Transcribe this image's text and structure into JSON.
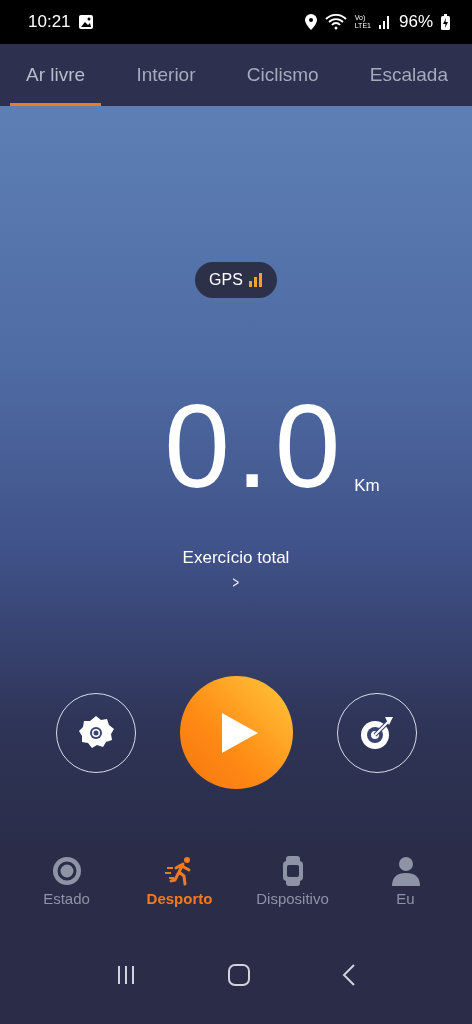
{
  "status_bar": {
    "time": "10:21",
    "network_top": "Vo)",
    "network_bottom": "LTE1",
    "battery": "96%"
  },
  "tabs": [
    {
      "label": "Ar livre",
      "selected": true
    },
    {
      "label": "Interior",
      "selected": false
    },
    {
      "label": "Ciclismo",
      "selected": false
    },
    {
      "label": "Escalada",
      "selected": false
    }
  ],
  "gps": {
    "label": "GPS"
  },
  "distance": {
    "value": "0.0",
    "unit": "Km",
    "caption": "Exercício total",
    "chevron": ">"
  },
  "bottom_nav": [
    {
      "label": "Estado",
      "kind": "status",
      "selected": false
    },
    {
      "label": "Desporto",
      "kind": "sport",
      "selected": true
    },
    {
      "label": "Dispositivo",
      "kind": "device",
      "selected": false
    },
    {
      "label": "Eu",
      "kind": "profile",
      "selected": false
    }
  ]
}
